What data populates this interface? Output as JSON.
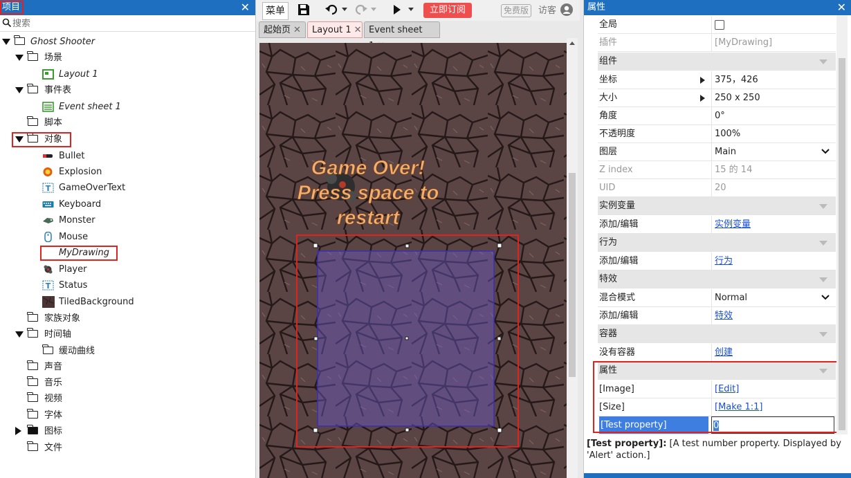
{
  "project_panel": {
    "title": "项目",
    "search_placeholder": "搜索",
    "tree": {
      "root": "Ghost Shooter",
      "layouts_folder": "场景",
      "layout_item": "Layout 1",
      "eventsheets_folder": "事件表",
      "eventsheet_item": "Event sheet 1",
      "scripts_folder": "脚本",
      "objects_folder": "对象",
      "objects": [
        "Bullet",
        "Explosion",
        "GameOverText",
        "Keyboard",
        "Monster",
        "Mouse",
        "MyDrawing",
        "Player",
        "Status",
        "TiledBackground"
      ],
      "families_folder": "家族对象",
      "timelines_folder": "时间轴",
      "easing_folder": "缓动曲线",
      "sounds_folder": "声音",
      "music_folder": "音乐",
      "videos_folder": "视频",
      "fonts_folder": "字体",
      "icons_folder": "图标",
      "files_folder": "文件"
    }
  },
  "toolbar": {
    "menu_label": "菜单",
    "subscribe_label": "立即订阅",
    "free_version_label": "免费版",
    "guest_label": "访客"
  },
  "tabs": [
    {
      "label": "起始页"
    },
    {
      "label": "Layout 1"
    },
    {
      "label": "Event sheet 1"
    }
  ],
  "canvas": {
    "game_over_text_line1": "Game Over!",
    "game_over_text_line2": "Press space to",
    "game_over_text_line3": "restart"
  },
  "properties_panel": {
    "title": "属性",
    "rows": [
      {
        "key": "全局",
        "value": ""
      },
      {
        "key": "插件",
        "value": "[MyDrawing]"
      },
      {
        "key": "组件",
        "value": ""
      },
      {
        "key": "坐标",
        "value": "375，426"
      },
      {
        "key": "大小",
        "value": "250 x 250"
      },
      {
        "key": "角度",
        "value": "0°"
      },
      {
        "key": "不透明度",
        "value": "100%"
      },
      {
        "key": "图层",
        "value": "Main"
      },
      {
        "key": "Z index",
        "value": "15 的 14"
      },
      {
        "key": "UID",
        "value": "20"
      },
      {
        "key": "实例变量",
        "value": ""
      },
      {
        "key": "添加/编辑",
        "value": "实例变量"
      },
      {
        "key": "行为",
        "value": ""
      },
      {
        "key": "添加/编辑",
        "value": "行为"
      },
      {
        "key": "特效",
        "value": ""
      },
      {
        "key": "混合模式",
        "value": "Normal"
      },
      {
        "key": "添加/编辑",
        "value": "特效"
      },
      {
        "key": "容器",
        "value": ""
      },
      {
        "key": "没有容器",
        "value": "创建"
      },
      {
        "key": "属性",
        "value": ""
      },
      {
        "key": "[Image]",
        "value": "[Edit]"
      },
      {
        "key": "[Size]",
        "value": "[Make 1:1]"
      },
      {
        "key": "[Test property]",
        "value": "0"
      }
    ],
    "description_name": "[Test property]:",
    "description_text": " [A test number property. Displayed by 'Alert' action.]"
  },
  "colors": {
    "panel_header": "#1f6fc0",
    "highlight_red": "#e0231f",
    "subscribe_red": "#ef4e4e",
    "link_blue": "#1a4fd1",
    "selected_row": "#3d7ee0"
  }
}
